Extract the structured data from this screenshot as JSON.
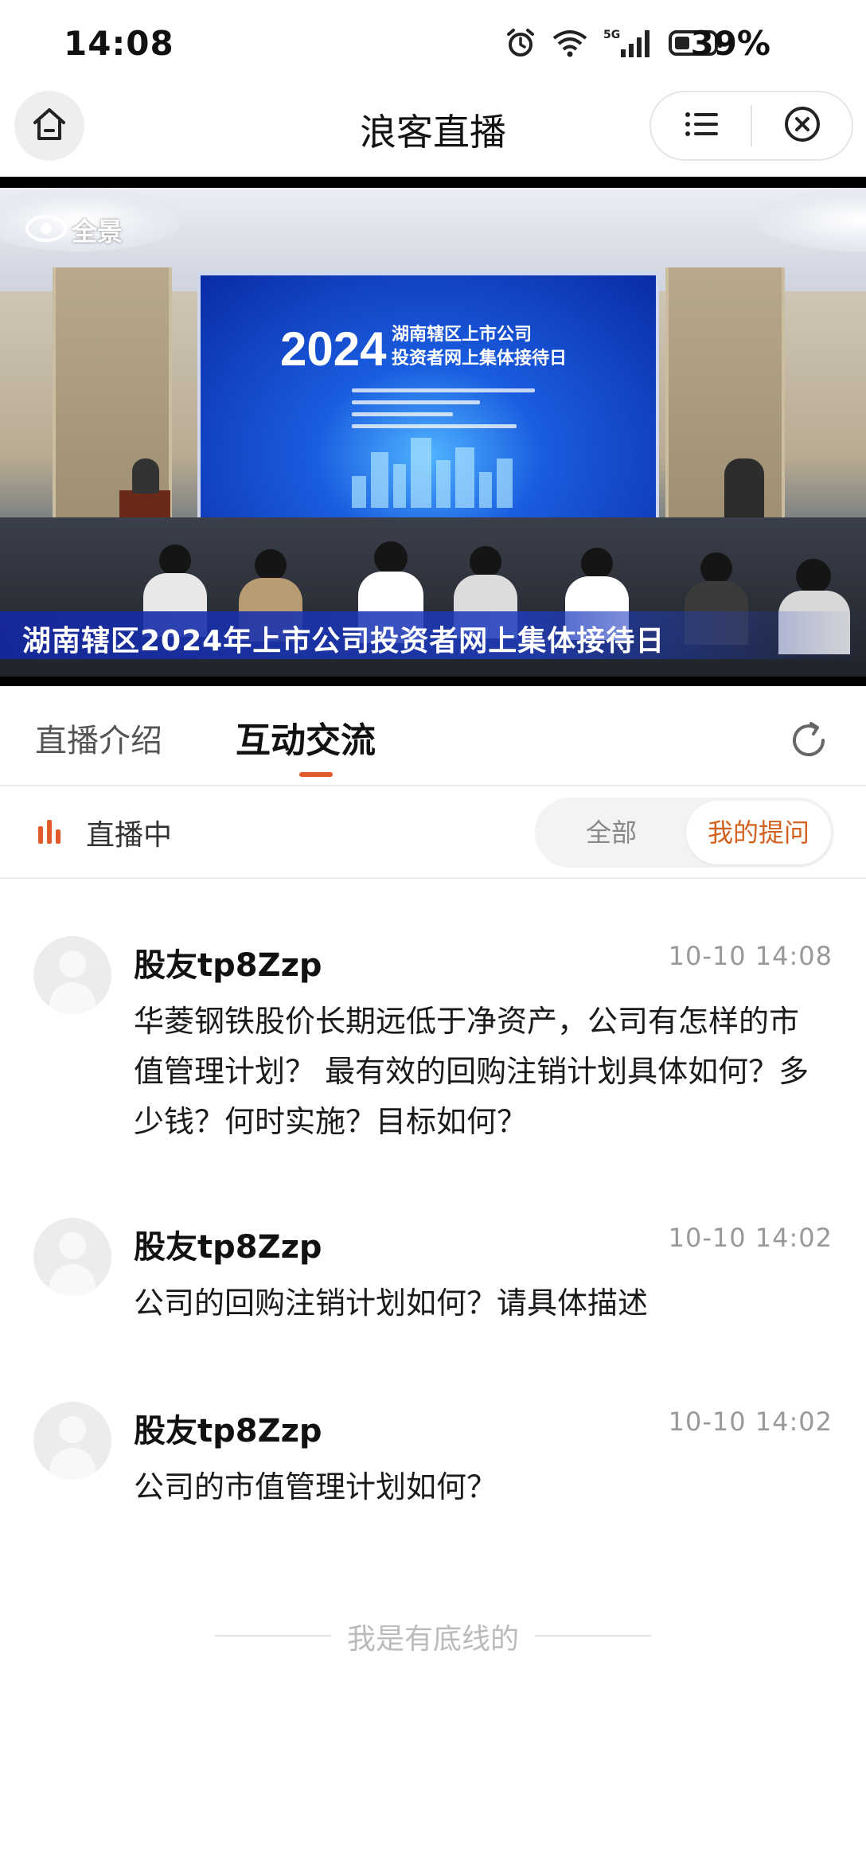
{
  "status_bar": {
    "time": "14:08",
    "battery_percent": "39%",
    "icons": [
      "alarm-icon",
      "wifi-icon",
      "5g-signal-icon",
      "battery-icon"
    ]
  },
  "header": {
    "title": "浪客直播",
    "home_icon": "home-icon",
    "menu_icon": "list-icon",
    "close_icon": "close-circle-icon"
  },
  "video": {
    "brand": "全景",
    "screen_year": "2024",
    "screen_title_line1": "湖南辖区上市公司",
    "screen_title_line2": "投资者网上集体接待日",
    "caption": "湖南辖区2024年上市公司投资者网上集体接待日"
  },
  "tabs": {
    "items": [
      {
        "label": "直播介绍",
        "active": false
      },
      {
        "label": "互动交流",
        "active": true
      }
    ],
    "accent_color": "#e05a2b"
  },
  "live_status": {
    "label": "直播中",
    "filter": {
      "options": [
        "全部",
        "我的提问"
      ],
      "selected": "我的提问"
    }
  },
  "questions": [
    {
      "user": "股友tp8Zzp",
      "time": "10-10 14:08",
      "text": "华菱钢铁股价长期远低于净资产，公司有怎样的市值管理计划？ 最有效的回购注销计划具体如何？多少钱？何时实施？目标如何？"
    },
    {
      "user": "股友tp8Zzp",
      "time": "10-10 14:02",
      "text": "公司的回购注销计划如何？请具体描述"
    },
    {
      "user": "股友tp8Zzp",
      "time": "10-10 14:02",
      "text": "公司的市值管理计划如何？"
    }
  ],
  "footer_note": "我是有底线的"
}
